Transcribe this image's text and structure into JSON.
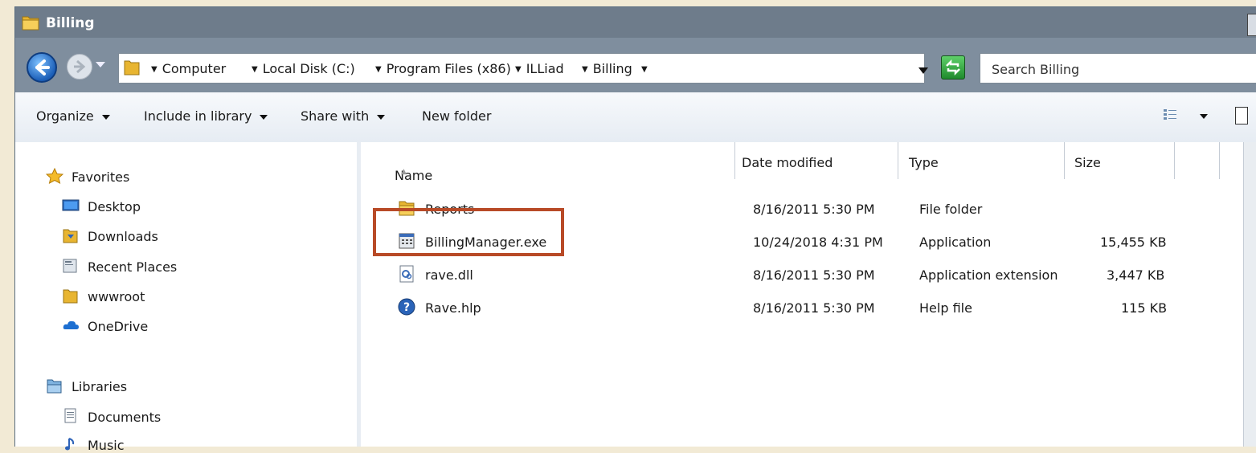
{
  "window": {
    "title": "Billing"
  },
  "address": {
    "breadcrumbs": [
      "Computer",
      "Local Disk (C:)",
      "Program Files (x86)",
      "ILLiad",
      "Billing"
    ],
    "search_placeholder": "Search Billing"
  },
  "toolbar": {
    "organize": "Organize",
    "include_in_library": "Include in library",
    "share_with": "Share with",
    "new_folder": "New folder"
  },
  "navigation": {
    "favorites_label": "Favorites",
    "favorites": [
      "Desktop",
      "Downloads",
      "Recent Places",
      "wwwroot",
      "OneDrive"
    ],
    "libraries_label": "Libraries",
    "libraries": [
      "Documents",
      "Music"
    ]
  },
  "columns": {
    "name": "Name",
    "date_modified": "Date modified",
    "type": "Type",
    "size": "Size"
  },
  "files": [
    {
      "name": "Reports",
      "date": "8/16/2011 5:30 PM",
      "type": "File folder",
      "size": "",
      "icon": "folder-icon"
    },
    {
      "name": "BillingManager.exe",
      "date": "10/24/2018 4:31 PM",
      "type": "Application",
      "size": "15,455 KB",
      "icon": "application-icon"
    },
    {
      "name": "rave.dll",
      "date": "8/16/2011 5:30 PM",
      "type": "Application extension",
      "size": "3,447 KB",
      "icon": "dll-icon"
    },
    {
      "name": "Rave.hlp",
      "date": "8/16/2011 5:30 PM",
      "type": "Help file",
      "size": "115 KB",
      "icon": "help-icon"
    }
  ],
  "colors": {
    "highlight": "#b84a27",
    "title_bar": "#6e7c8b",
    "page_background": "#f2ead5"
  }
}
